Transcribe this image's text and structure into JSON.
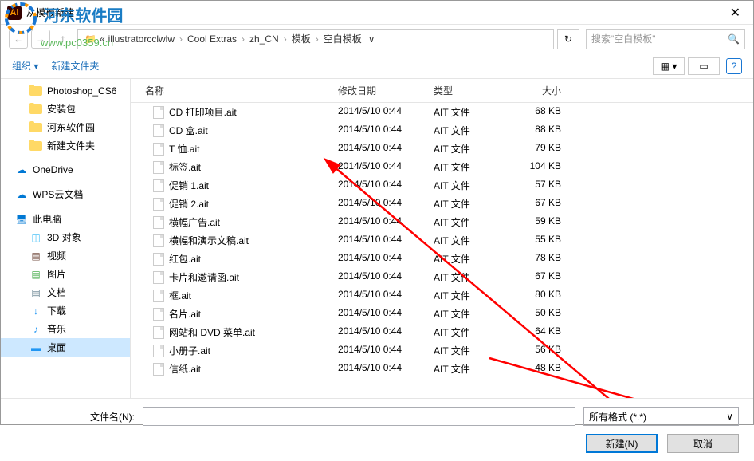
{
  "watermark": {
    "site_name": "河东软件园",
    "url": "www.pc0359.cn"
  },
  "titlebar": {
    "title": "从模板新建"
  },
  "breadcrumb": {
    "items": [
      "«",
      "illustratorcclwlw",
      "Cool Extras",
      "zh_CN",
      "模板",
      "空白模板"
    ]
  },
  "search": {
    "placeholder": "搜索\"空白模板\""
  },
  "toolbar": {
    "organize": "组织 ▾",
    "newfolder": "新建文件夹"
  },
  "sidebar": {
    "items": [
      {
        "label": "Photoshop_CS6",
        "icon": "folder"
      },
      {
        "label": "安装包",
        "icon": "folder"
      },
      {
        "label": "河东软件园",
        "icon": "folder"
      },
      {
        "label": "新建文件夹",
        "icon": "folder"
      },
      {
        "label": "",
        "icon": "spacer"
      },
      {
        "label": "OneDrive",
        "icon": "onedrive"
      },
      {
        "label": "",
        "icon": "spacer"
      },
      {
        "label": "WPS云文档",
        "icon": "wps"
      },
      {
        "label": "",
        "icon": "spacer"
      },
      {
        "label": "此电脑",
        "icon": "pc"
      },
      {
        "label": "3D 对象",
        "icon": "3d"
      },
      {
        "label": "视频",
        "icon": "video"
      },
      {
        "label": "图片",
        "icon": "image"
      },
      {
        "label": "文档",
        "icon": "doc"
      },
      {
        "label": "下载",
        "icon": "download"
      },
      {
        "label": "音乐",
        "icon": "music"
      },
      {
        "label": "桌面",
        "icon": "desktop",
        "selected": true
      }
    ]
  },
  "columns": {
    "name": "名称",
    "date": "修改日期",
    "type": "类型",
    "size": "大小"
  },
  "files": [
    {
      "name": "CD 打印项目.ait",
      "date": "2014/5/10 0:44",
      "type": "AIT 文件",
      "size": "68 KB"
    },
    {
      "name": "CD 盒.ait",
      "date": "2014/5/10 0:44",
      "type": "AIT 文件",
      "size": "88 KB"
    },
    {
      "name": "T 恤.ait",
      "date": "2014/5/10 0:44",
      "type": "AIT 文件",
      "size": "79 KB"
    },
    {
      "name": "标签.ait",
      "date": "2014/5/10 0:44",
      "type": "AIT 文件",
      "size": "104 KB"
    },
    {
      "name": "促销 1.ait",
      "date": "2014/5/10 0:44",
      "type": "AIT 文件",
      "size": "57 KB"
    },
    {
      "name": "促销 2.ait",
      "date": "2014/5/10 0:44",
      "type": "AIT 文件",
      "size": "67 KB"
    },
    {
      "name": "横幅广告.ait",
      "date": "2014/5/10 0:44",
      "type": "AIT 文件",
      "size": "59 KB"
    },
    {
      "name": "横幅和演示文稿.ait",
      "date": "2014/5/10 0:44",
      "type": "AIT 文件",
      "size": "55 KB"
    },
    {
      "name": "红包.ait",
      "date": "2014/5/10 0:44",
      "type": "AIT 文件",
      "size": "78 KB"
    },
    {
      "name": "卡片和邀请函.ait",
      "date": "2014/5/10 0:44",
      "type": "AIT 文件",
      "size": "67 KB"
    },
    {
      "name": "框.ait",
      "date": "2014/5/10 0:44",
      "type": "AIT 文件",
      "size": "80 KB"
    },
    {
      "name": "名片.ait",
      "date": "2014/5/10 0:44",
      "type": "AIT 文件",
      "size": "50 KB"
    },
    {
      "name": "网站和 DVD 菜单.ait",
      "date": "2014/5/10 0:44",
      "type": "AIT 文件",
      "size": "64 KB"
    },
    {
      "name": "小册子.ait",
      "date": "2014/5/10 0:44",
      "type": "AIT 文件",
      "size": "56 KB"
    },
    {
      "name": "信纸.ait",
      "date": "2014/5/10 0:44",
      "type": "AIT 文件",
      "size": "48 KB"
    }
  ],
  "footer": {
    "filename_label": "文件名(N):",
    "filename_value": "",
    "format": "所有格式 (*.*)",
    "new_btn": "新建(N)",
    "cancel_btn": "取消"
  }
}
